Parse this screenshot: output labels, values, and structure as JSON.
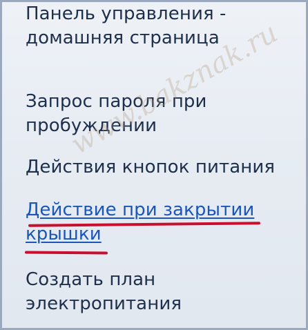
{
  "links": {
    "home": [
      "Панель управления -",
      "домашняя страница"
    ],
    "password": [
      "Запрос пароля при",
      "пробуждении"
    ],
    "power_buttons": [
      "Действия кнопок питания"
    ],
    "lid_close": [
      "Действие при закрытии",
      "крышки"
    ],
    "create_plan": [
      "Создать план",
      "электропитания"
    ]
  },
  "watermark": "www.bakznak.ru",
  "colors": {
    "background": "#e7ecf3",
    "text": "#1d2f4a",
    "active_link": "#1a56b8",
    "highlight_underline": "#c8102e"
  }
}
